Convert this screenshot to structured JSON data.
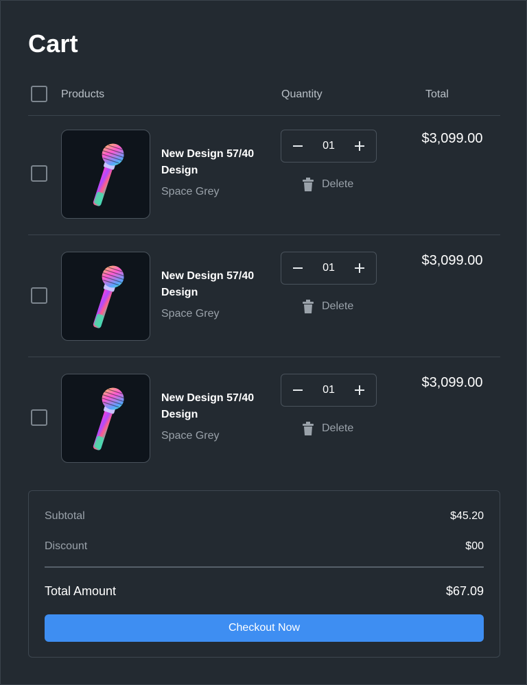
{
  "page": {
    "title": "Cart"
  },
  "table_header": {
    "products": "Products",
    "quantity": "Quantity",
    "total": "Total"
  },
  "items": [
    {
      "name": "New Design 57/40 Design",
      "variant": "Space Grey",
      "quantity": "01",
      "price": "$3,099.00",
      "delete_label": "Delete",
      "image_icon": "microphone-icon"
    },
    {
      "name": "New Design 57/40 Design",
      "variant": "Space Grey",
      "quantity": "01",
      "price": "$3,099.00",
      "delete_label": "Delete",
      "image_icon": "microphone-icon"
    },
    {
      "name": "New Design 57/40 Design",
      "variant": "Space Grey",
      "quantity": "01",
      "price": "$3,099.00",
      "delete_label": "Delete",
      "image_icon": "microphone-icon"
    }
  ],
  "summary": {
    "subtotal_label": "Subtotal",
    "subtotal_value": "$45.20",
    "discount_label": "Discount",
    "discount_value": "$00",
    "total_label": "Total Amount",
    "total_value": "$67.09",
    "checkout_label": "Checkout Now"
  },
  "colors": {
    "background": "#232a31",
    "accent": "#3e8ef2",
    "muted_text": "#9aa2aa"
  },
  "icons": {
    "minus": "minus-icon",
    "plus": "plus-icon",
    "delete": "trash-icon"
  }
}
